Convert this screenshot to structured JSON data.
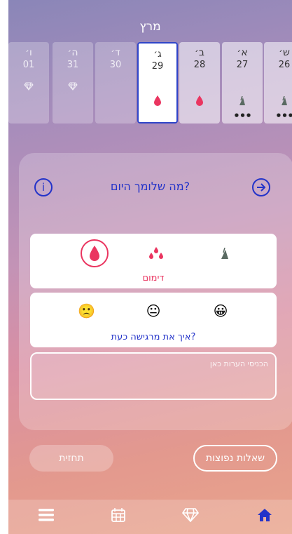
{
  "header": {
    "month": "מרץ"
  },
  "days": [
    {
      "name": "ש׳",
      "num": "26",
      "icon": "tampon-icon"
    },
    {
      "name": "א׳",
      "num": "27",
      "icon": "tampon-icon"
    },
    {
      "name": "ב׳",
      "num": "28",
      "icon": "drop-icon"
    },
    {
      "name": "ג׳",
      "num": "29",
      "icon": "drop-icon"
    },
    {
      "name": "ד׳",
      "num": "30",
      "icon": ""
    },
    {
      "name": "ה׳",
      "num": "31",
      "icon": "diamond-icon"
    },
    {
      "name": "ו׳",
      "num": "01",
      "icon": "diamond-icon"
    }
  ],
  "panel": {
    "title": "מה שלומך היום?",
    "info_icon": "info-icon",
    "next_icon": "arrow-right-circle-icon",
    "flow_label": "דימום",
    "mood_label": "איך את מרגישה כעת?",
    "notes_placeholder": "הכניסי הערות כאן"
  },
  "buttons": {
    "forecast": "תחזית",
    "faq": "שאלות נפוצות"
  },
  "nav": {
    "icons": [
      "menu-icon",
      "calendar-icon",
      "diamond-icon",
      "home-icon"
    ]
  },
  "colors": {
    "accent_blue": "#2333c9",
    "accent_pink": "#ea3560"
  }
}
